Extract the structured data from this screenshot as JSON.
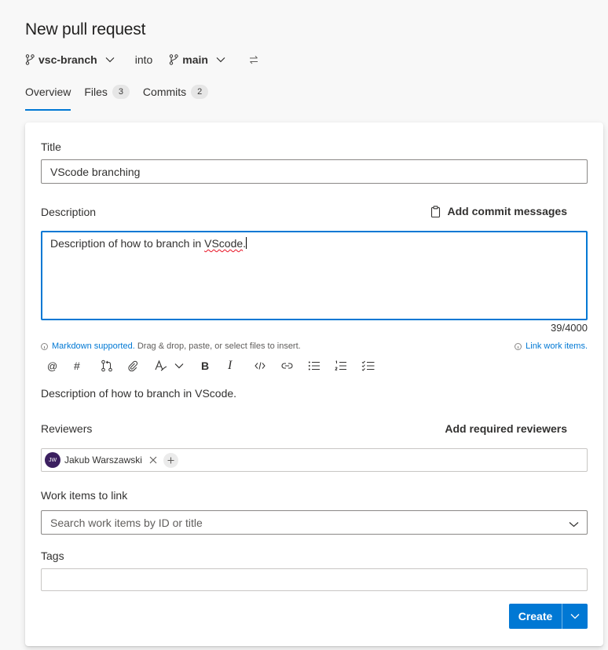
{
  "page": {
    "title": "New pull request"
  },
  "branches": {
    "source": "vsc-branch",
    "connector": "into",
    "target": "main"
  },
  "tabs": [
    {
      "label": "Overview",
      "count": null,
      "active": true
    },
    {
      "label": "Files",
      "count": "3",
      "active": false
    },
    {
      "label": "Commits",
      "count": "2",
      "active": false
    }
  ],
  "form": {
    "title_label": "Title",
    "title_value": "VScode branching",
    "description_label": "Description",
    "add_commit_messages": "Add commit messages",
    "description_text": "Description of how to branch in ",
    "description_misspelled": "VScode",
    "description_tail": ".",
    "char_counter": "39/4000",
    "markdown_link": "Markdown supported.",
    "markdown_hint": " Drag & drop, paste, or select files to insert.",
    "link_work_items": "Link work items.",
    "preview_text": "Description of how to branch in VScode.",
    "reviewers_label": "Reviewers",
    "add_required_reviewers": "Add required reviewers",
    "reviewer": {
      "initials": "JW",
      "name": "Jakub Warszawski"
    },
    "work_items_label": "Work items to link",
    "work_items_placeholder": "Search work items by ID or title",
    "tags_label": "Tags",
    "tags_value": "",
    "create_label": "Create"
  },
  "toolbar_icons": [
    "mention-icon",
    "hash-icon",
    "pull-request-icon",
    "attach-icon",
    "highlight-icon",
    "chevron-down-icon",
    "bold-icon",
    "italic-icon",
    "code-icon",
    "link-icon",
    "bullet-list-icon",
    "numbered-list-icon",
    "checklist-icon"
  ],
  "toolbar_glyphs": {
    "mention": "@",
    "hash": "#",
    "bold": "B",
    "italic": "I"
  },
  "colors": {
    "accent": "#0078d4",
    "avatar": "#3b1f5f",
    "spellcheck": "#e81123"
  }
}
